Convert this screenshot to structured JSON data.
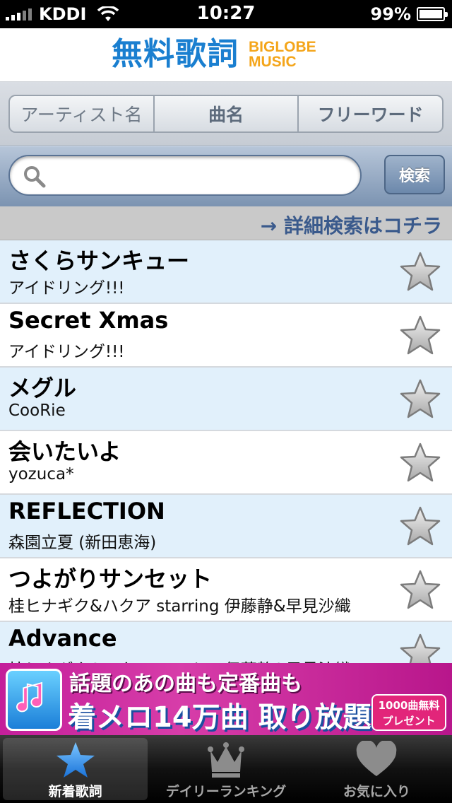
{
  "status_bar": {
    "carrier": "KDDI",
    "time": "10:27",
    "battery": "99%",
    "battery_level": 0.99
  },
  "header": {
    "logo_main": "無料歌詞",
    "logo_sub_line1": "BIGLOBE",
    "logo_sub_line2": "MUSIC"
  },
  "segments": {
    "items": [
      "アーティスト名",
      "曲名",
      "フリーワード"
    ],
    "selected": null
  },
  "search": {
    "placeholder": "",
    "value": "",
    "button_label": "検索"
  },
  "detail_link": "→ 詳細検索はコチラ",
  "songs": [
    {
      "title": "さくらサンキュー",
      "artist": "アイドリング!!!"
    },
    {
      "title": "Secret Xmas",
      "artist": "アイドリング!!!"
    },
    {
      "title": "メグル",
      "artist": "CooRie"
    },
    {
      "title": "会いたいよ",
      "artist": "yozuca*"
    },
    {
      "title": "REFLECTION",
      "artist": "森園立夏 (新田恵海)"
    },
    {
      "title": "つよがりサンセット",
      "artist": "桂ヒナギク&ハクア starring 伊藤静&早見沙織"
    },
    {
      "title": "Advance",
      "artist": "桂ヒナギク&ハクア starring 伊藤静&早見沙織"
    }
  ],
  "banner": {
    "line1": "話題のあの曲も定番曲も",
    "line2": "着メロ14万曲 取り放題!!",
    "badge_line1": "1000曲無料",
    "badge_line2": "プレゼント"
  },
  "tabs": [
    {
      "label": "新着歌詞",
      "icon": "star-icon",
      "active": true
    },
    {
      "label": "デイリーランキング",
      "icon": "crown-icon",
      "active": false
    },
    {
      "label": "お気に入り",
      "icon": "heart-icon",
      "active": false
    }
  ],
  "colors": {
    "logo_blue": "#1a7fd0",
    "logo_orange": "#f4a51a",
    "row_highlight": "#e1f0fb",
    "link_blue": "#3a5a8c"
  }
}
